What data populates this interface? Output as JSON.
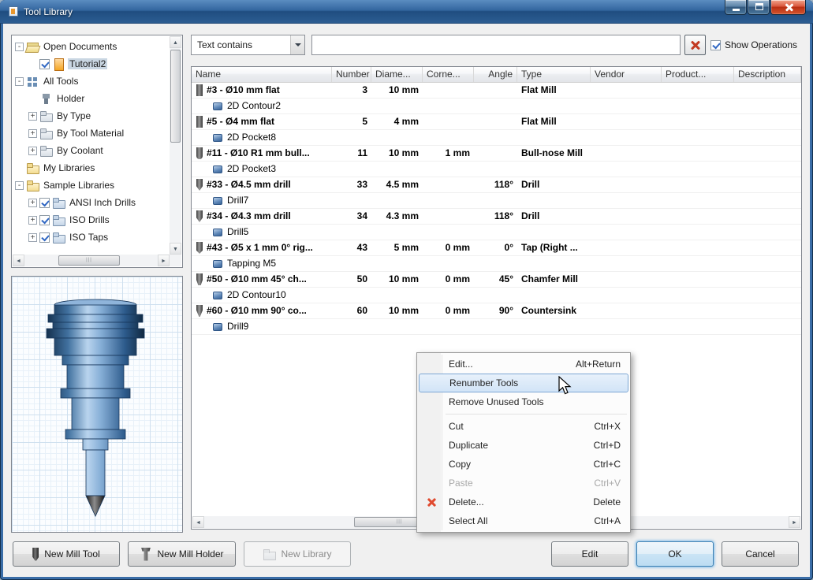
{
  "window": {
    "title": "Tool Library"
  },
  "colors": {
    "titlebar_blue": "#2c5d92",
    "border_blue": "#3a6da7",
    "close_red": "#c9331a",
    "menu_highlight": "#d2e4f7",
    "check_blue": "#2f66c2",
    "tree_selection": "#c9d6e2"
  },
  "tree": {
    "items": [
      {
        "label": "Open Documents",
        "level": 0,
        "icon": "open-folder",
        "expander": "expanded"
      },
      {
        "label": "Tutorial2",
        "level": 1,
        "icon": "document",
        "checked": true,
        "selected": true
      },
      {
        "label": "All Tools",
        "level": 0,
        "icon": "all-tools",
        "expander": "expanded"
      },
      {
        "label": "Holder",
        "level": 1,
        "icon": "holder"
      },
      {
        "label": "By Type",
        "level": 1,
        "icon": "category",
        "expander": "collapsed"
      },
      {
        "label": "By Tool Material",
        "level": 1,
        "icon": "category",
        "expander": "collapsed"
      },
      {
        "label": "By Coolant",
        "level": 1,
        "icon": "category",
        "expander": "collapsed"
      },
      {
        "label": "My Libraries",
        "level": 0,
        "icon": "folder"
      },
      {
        "label": "Sample Libraries",
        "level": 0,
        "icon": "folder",
        "expander": "expanded"
      },
      {
        "label": "ANSI Inch Drills",
        "level": 1,
        "icon": "library",
        "checked": true,
        "expander": "collapsed"
      },
      {
        "label": "ISO Drills",
        "level": 1,
        "icon": "library",
        "checked": true,
        "expander": "collapsed"
      },
      {
        "label": "ISO Taps",
        "level": 1,
        "icon": "library",
        "checked": true,
        "expander": "collapsed"
      }
    ]
  },
  "filter": {
    "mode": "Text contains",
    "search_value": "",
    "show_operations_label": "Show Operations",
    "show_operations_checked": true
  },
  "table": {
    "columns": [
      {
        "label": "Name"
      },
      {
        "label": "Number"
      },
      {
        "label": "Diame..."
      },
      {
        "label": "Corne..."
      },
      {
        "label": "Angle"
      },
      {
        "label": "Type"
      },
      {
        "label": "Vendor"
      },
      {
        "label": "Product..."
      },
      {
        "label": "Description"
      }
    ],
    "rows": [
      {
        "name": "#3 - Ø10 mm flat",
        "icon": "flat-mill",
        "number": "3",
        "diameter": "10 mm",
        "corner": "",
        "angle": "",
        "type": "Flat Mill",
        "vendor": "",
        "product": "",
        "description": "",
        "operations": [
          "2D Contour2"
        ]
      },
      {
        "name": "#5 - Ø4 mm flat",
        "icon": "flat-mill",
        "number": "5",
        "diameter": "4 mm",
        "corner": "",
        "angle": "",
        "type": "Flat Mill",
        "vendor": "",
        "product": "",
        "description": "",
        "operations": [
          "2D Pocket8"
        ]
      },
      {
        "name": "#11 - Ø10 R1 mm bull...",
        "icon": "bull-nose-mill",
        "number": "11",
        "diameter": "10 mm",
        "corner": "1 mm",
        "angle": "",
        "type": "Bull-nose Mill",
        "vendor": "",
        "product": "",
        "description": "",
        "operations": [
          "2D Pocket3"
        ]
      },
      {
        "name": "#33 - Ø4.5 mm drill",
        "icon": "drill",
        "number": "33",
        "diameter": "4.5 mm",
        "corner": "",
        "angle": "118°",
        "type": "Drill",
        "vendor": "",
        "product": "",
        "description": "",
        "operations": [
          "Drill7"
        ]
      },
      {
        "name": "#34 - Ø4.3 mm drill",
        "icon": "drill",
        "number": "34",
        "diameter": "4.3 mm",
        "corner": "",
        "angle": "118°",
        "type": "Drill",
        "vendor": "",
        "product": "",
        "description": "",
        "operations": [
          "Drill5"
        ]
      },
      {
        "name": "#43 - Ø5 x 1 mm 0° rig...",
        "icon": "tap",
        "number": "43",
        "diameter": "5 mm",
        "corner": "0 mm",
        "angle": "0°",
        "type": "Tap (Right ...",
        "vendor": "",
        "product": "",
        "description": "",
        "operations": [
          "Tapping M5"
        ]
      },
      {
        "name": "#50 - Ø10 mm 45° ch...",
        "icon": "chamfer-mill",
        "number": "50",
        "diameter": "10 mm",
        "corner": "0 mm",
        "angle": "45°",
        "type": "Chamfer Mill",
        "vendor": "",
        "product": "",
        "description": "",
        "operations": [
          "2D Contour10"
        ]
      },
      {
        "name": "#60 - Ø10 mm 90° co...",
        "icon": "countersink",
        "number": "60",
        "diameter": "10 mm",
        "corner": "0 mm",
        "angle": "90°",
        "type": "Countersink",
        "vendor": "",
        "product": "",
        "description": "",
        "operations": [
          "Drill9"
        ]
      }
    ]
  },
  "context_menu": {
    "items": [
      {
        "label": "Edit...",
        "shortcut": "Alt+Return"
      },
      {
        "label": "Renumber Tools",
        "shortcut": "",
        "highlighted": true
      },
      {
        "label": "Remove Unused Tools",
        "shortcut": ""
      },
      {
        "type": "separator"
      },
      {
        "label": "Cut",
        "shortcut": "Ctrl+X"
      },
      {
        "label": "Duplicate",
        "shortcut": "Ctrl+D"
      },
      {
        "label": "Copy",
        "shortcut": "Ctrl+C"
      },
      {
        "label": "Paste",
        "shortcut": "Ctrl+V",
        "disabled": true
      },
      {
        "label": "Delete...",
        "shortcut": "Delete",
        "icon": "delete"
      },
      {
        "label": "Select All",
        "shortcut": "Ctrl+A"
      }
    ]
  },
  "footer": {
    "new_mill_tool": "New Mill Tool",
    "new_mill_holder": "New Mill Holder",
    "new_library": "New Library",
    "edit": "Edit",
    "ok": "OK",
    "cancel": "Cancel"
  }
}
